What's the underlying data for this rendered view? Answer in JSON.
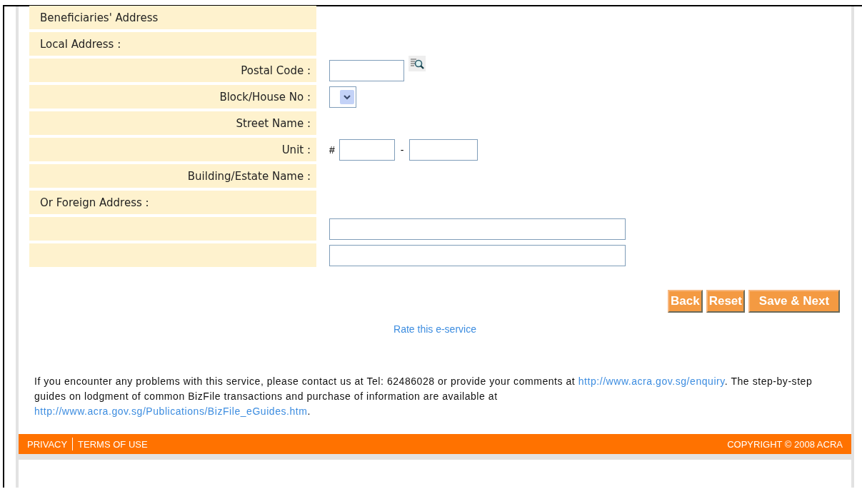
{
  "form": {
    "rows": [
      {
        "kind": "section",
        "label": "Beneficiaries' Address"
      },
      {
        "kind": "section",
        "label": "Local Address :"
      },
      {
        "kind": "postal",
        "label": "Postal Code :"
      },
      {
        "kind": "select",
        "label": "Block/House No :"
      },
      {
        "kind": "static",
        "label": "Street Name :"
      },
      {
        "kind": "unit",
        "label": "Unit :",
        "prefix": "#",
        "separator": "-"
      },
      {
        "kind": "static",
        "label": "Building/Estate Name :"
      },
      {
        "kind": "section",
        "label": "Or Foreign Address :"
      },
      {
        "kind": "line"
      },
      {
        "kind": "line"
      }
    ]
  },
  "buttons": [
    "Back",
    "Reset",
    "Save & Next"
  ],
  "rate_link": "Rate this e-service",
  "contact": {
    "before": "If you encounter any problems with this service, please contact us at Tel: 62486028 or provide your comments at ",
    "link1": "http://www.acra.gov.sg/enquiry",
    "middle": ". The step-by-step guides on lodgment of common BizFile transactions and purchase of information are available at ",
    "link2": "http://www.acra.gov.sg/Publications/BizFile_eGuides.htm",
    "after": "."
  },
  "footer": {
    "links": [
      "PRIVACY",
      "TERMS OF USE"
    ],
    "copyright": "COPYRIGHT © 2008 ACRA"
  }
}
